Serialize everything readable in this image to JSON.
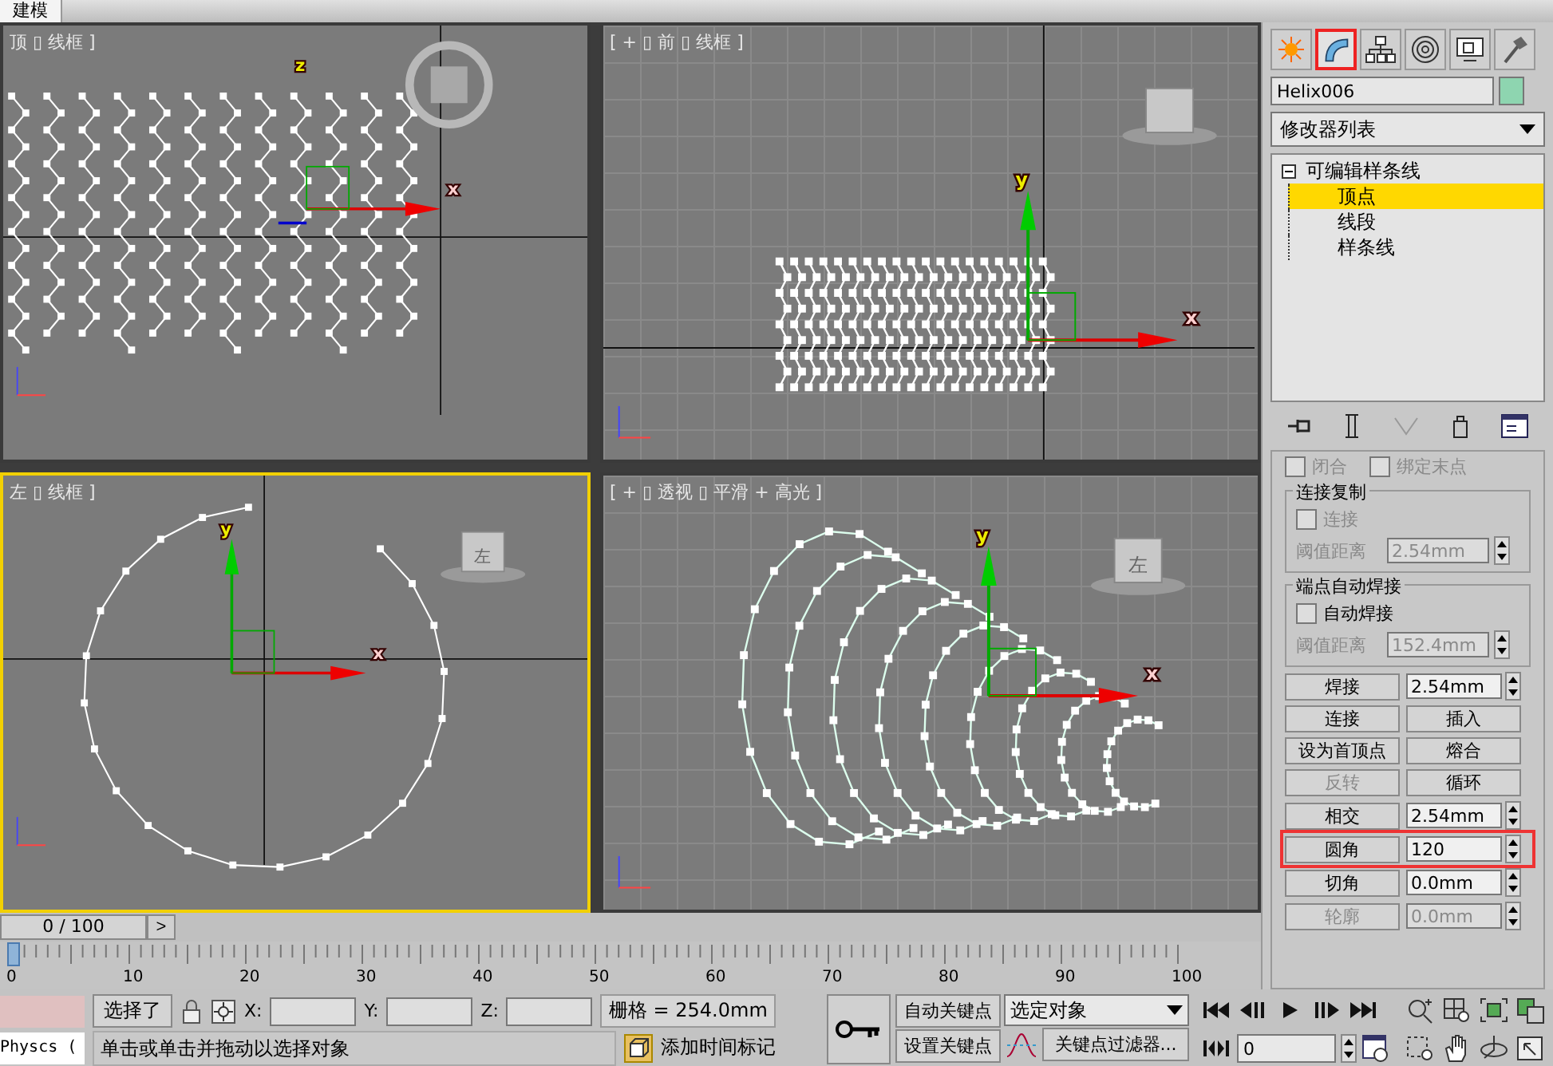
{
  "title_tab": "建模",
  "viewports": [
    {
      "kind": "top",
      "label": "顶 ▯ 线框 ]",
      "active": false,
      "axis_labels": [
        "x",
        "z"
      ]
    },
    {
      "kind": "front",
      "label": "[ + ▯ 前 ▯ 线框 ]",
      "active": false,
      "axis_labels": [
        "x",
        "y"
      ]
    },
    {
      "kind": "left",
      "label": "左 ▯ 线框 ]",
      "active": true,
      "axis_labels": [
        "x",
        "y"
      ],
      "cube_label": "左"
    },
    {
      "kind": "perspective",
      "label": "[ + ▯ 透视 ▯ 平滑 + 高光 ]",
      "active": false,
      "axis_labels": [
        "x",
        "y"
      ],
      "cube_label": "左"
    }
  ],
  "time_slider": {
    "text": "0 / 100",
    "next": ">",
    "level": 0
  },
  "timeline_ticks": [
    "0",
    "10",
    "20",
    "30",
    "40",
    "50",
    "60",
    "70",
    "80",
    "90",
    "100"
  ],
  "command_panel": {
    "tabs": [
      {
        "kind": "create",
        "selected": false
      },
      {
        "kind": "modify",
        "selected": true
      },
      {
        "kind": "hierarchy",
        "selected": false
      },
      {
        "kind": "motion",
        "selected": false
      },
      {
        "kind": "display",
        "selected": false
      },
      {
        "kind": "utilities",
        "selected": false
      }
    ],
    "object_name": "Helix006",
    "modifier_list": "修改器列表",
    "stack": [
      {
        "label": "可编辑样条线",
        "expanded": true,
        "children": [
          {
            "label": "顶点",
            "selected": true
          },
          {
            "label": "线段",
            "selected": false
          },
          {
            "label": "样条线",
            "selected": false
          }
        ]
      }
    ],
    "top_checks": [
      {
        "label": "闭合",
        "checked": false,
        "disabled": true
      },
      {
        "label": "绑定末点",
        "checked": false,
        "disabled": true
      }
    ],
    "groups": [
      {
        "title": "连接复制",
        "check": {
          "label": "连接",
          "checked": false,
          "disabled": true
        },
        "threshold_label": "阈值距离",
        "threshold": "2.54mm",
        "threshold_disabled": true
      },
      {
        "title": "端点自动焊接",
        "check": {
          "label": "自动焊接",
          "checked": false,
          "disabled": false
        },
        "threshold_label": "阈值距离",
        "threshold": "152.4mm",
        "threshold_disabled": true
      }
    ],
    "rows": [
      {
        "highlighted": false,
        "items": [
          {
            "kind": "button",
            "label": "焊接",
            "disabled": false
          },
          {
            "kind": "spinner",
            "value": "2.54mm",
            "disabled": false
          }
        ]
      },
      {
        "highlighted": false,
        "items": [
          {
            "kind": "button",
            "label": "连接",
            "disabled": false
          },
          {
            "kind": "button",
            "label": "插入",
            "disabled": false
          }
        ]
      },
      {
        "highlighted": false,
        "items": [
          {
            "kind": "button",
            "label": "设为首顶点",
            "disabled": false
          },
          {
            "kind": "button",
            "label": "熔合",
            "disabled": false
          }
        ]
      },
      {
        "highlighted": false,
        "items": [
          {
            "kind": "button",
            "label": "反转",
            "disabled": true
          },
          {
            "kind": "button",
            "label": "循环",
            "disabled": false
          }
        ]
      },
      {
        "highlighted": false,
        "items": [
          {
            "kind": "button",
            "label": "相交",
            "disabled": false
          },
          {
            "kind": "spinner",
            "value": "2.54mm",
            "disabled": false
          }
        ]
      },
      {
        "highlighted": true,
        "items": [
          {
            "kind": "button",
            "label": "圆角",
            "disabled": false
          },
          {
            "kind": "spinner",
            "value": "120",
            "disabled": false
          }
        ]
      },
      {
        "highlighted": false,
        "items": [
          {
            "kind": "button",
            "label": "切角",
            "disabled": false
          },
          {
            "kind": "spinner",
            "value": "0.0mm",
            "disabled": false
          }
        ]
      },
      {
        "highlighted": false,
        "items": [
          {
            "kind": "button",
            "label": "轮廓",
            "disabled": true
          },
          {
            "kind": "spinner",
            "value": "0.0mm",
            "disabled": true
          }
        ]
      }
    ]
  },
  "status": {
    "script_field": "Physcs (",
    "selection": "选择了",
    "x_label": "X:",
    "y_label": "Y:",
    "z_label": "Z:",
    "grid": "栅格 = 254.0mm",
    "prompt": "单击或单击并拖动以选择对象",
    "time_tag": "添加时间标记",
    "auto_key": "自动关键点",
    "set_key": "设置关键点",
    "key_set": "选定对象",
    "key_filters": "关键点过滤器...",
    "frame": "0"
  }
}
